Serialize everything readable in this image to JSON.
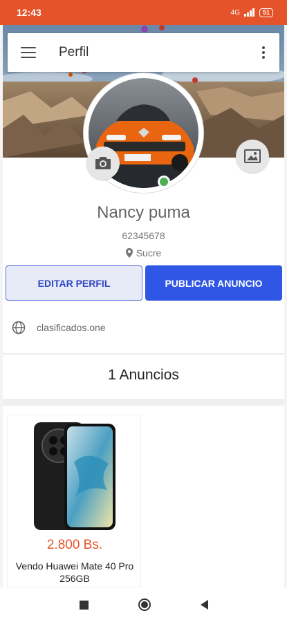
{
  "status_bar": {
    "time": "12:43",
    "network": "4G",
    "battery": "51"
  },
  "toolbar": {
    "title": "Perfil",
    "menu_icon": "menu-icon",
    "more_icon": "more-vert-icon"
  },
  "profile": {
    "name": "Nancy puma",
    "phone": "62345678",
    "location": "Sucre",
    "online_color": "#4caf50"
  },
  "actions": {
    "edit_label": "EDITAR PERFIL",
    "publish_label": "PUBLICAR ANUNCIO"
  },
  "website": "clasificados.one",
  "ads": {
    "count_label": "1 Anuncios",
    "items": [
      {
        "price": "2.800 Bs.",
        "title": "Vendo Huawei Mate 40 Pro 256GB"
      }
    ]
  },
  "colors": {
    "accent": "#e5532a",
    "primary": "#2f56e4"
  }
}
